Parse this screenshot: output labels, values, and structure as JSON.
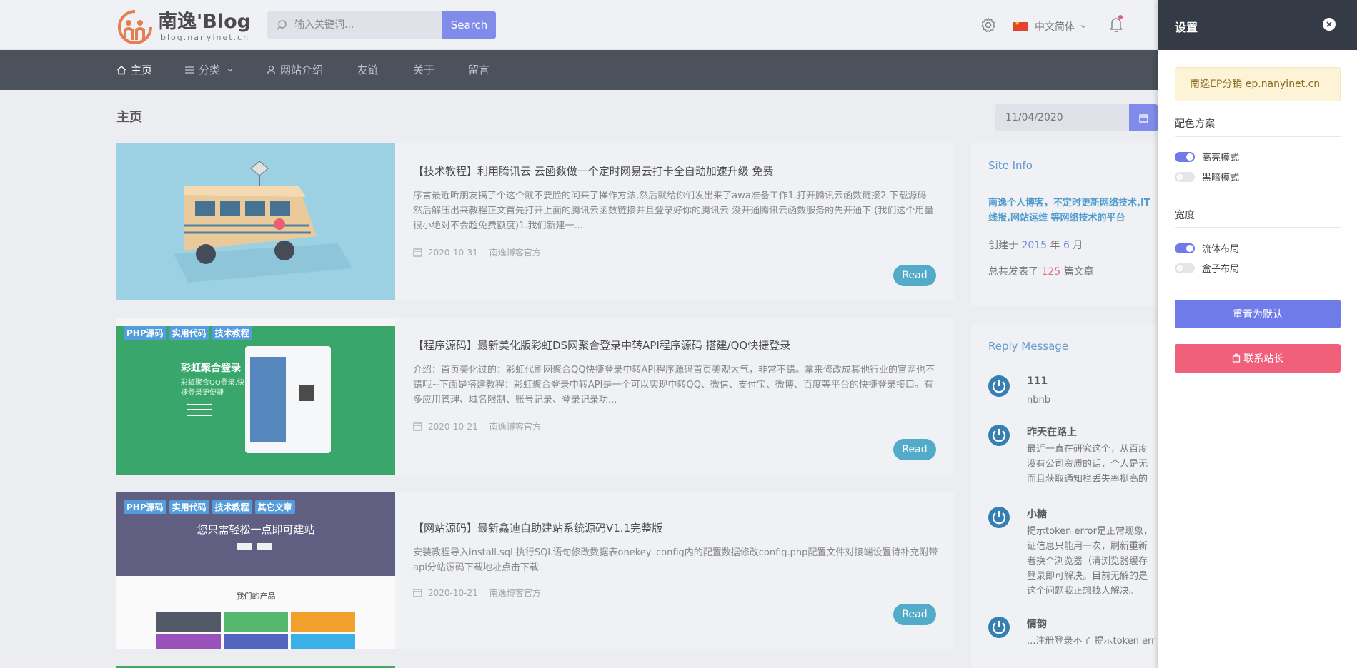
{
  "header": {
    "logo_title": "南逸'Blog",
    "logo_sub": "blog.nanyinet.cn",
    "search_placeholder": "输入关键词...",
    "search_label": "Search",
    "language": "中文简体"
  },
  "nav": {
    "items": [
      {
        "label": "主页",
        "icon": "home-icon"
      },
      {
        "label": "分类",
        "icon": "menu-icon"
      },
      {
        "label": "网站介绍",
        "icon": "user-icon"
      },
      {
        "label": "友链"
      },
      {
        "label": "关于"
      },
      {
        "label": "留言"
      }
    ]
  },
  "page": {
    "title": "主页",
    "date": "11/04/2020"
  },
  "articles": [
    {
      "title": "【技术教程】利用腾讯云 云函数做一个定时网易云打卡全自动加速升级 免费",
      "excerpt": "序言最近听朋友搞了个这个就不要脸的问来了操作方法,然后就给你们发出来了awa准备工作1.打开腾讯云函数链接2.下载源码-然后解压出来教程正文首先打开上面的腾讯云函数链接并且登录好你的腾讯云 没开通腾讯云函数服务的先开通下 (我们这个用量很小绝对不会超免费额度)1.我们新建一...",
      "date": "2020-10-31",
      "author": "南逸博客官方",
      "read_label": "Read",
      "tags": []
    },
    {
      "title": "【程序源码】最新美化版彩虹DS网聚合登录中转API程序源码 搭建/QQ快捷登录",
      "excerpt": "介绍：首页美化过的：彩虹代刷网聚合QQ快捷登录中转API程序源码首页美观大气，非常不错。拿来修改成其他行业的官网也不错哦~下面是搭建教程：彩虹聚合登录中转API是一个可以实现中转QQ、微信、支付宝、微博、百度等平台的快捷登录接口。有多应用管理、域名限制、账号记录、登录记录功...",
      "date": "2020-10-21",
      "author": "南逸博客官方",
      "read_label": "Read",
      "tags": [
        "PHP源码",
        "实用代码",
        "技术教程"
      ],
      "thumb_text": "彩虹聚合登录",
      "thumb_sub": "彩虹聚合QQ登录,快捷登录更便捷"
    },
    {
      "title": "【网站源码】最新鑫迪自助建站系统源码V1.1完整版",
      "excerpt": "安装教程导入install.sql 执行SQL语句修改数据表onekey_config内的配置数据修改config.php配置文件对接端设置待补充附带api分站源码下载地址点击下载",
      "date": "2020-10-21",
      "author": "南逸博客官方",
      "read_label": "Read",
      "tags": [
        "PHP源码",
        "实用代码",
        "技术教程",
        "其它文章"
      ],
      "thumb_text": "您只需轻松一点即可建站",
      "thumb_sub": "我们的产品"
    }
  ],
  "site_info": {
    "title": "Site Info",
    "desc": "南逸个人博客，不定时更新网络技术,IT线报,网站运维 等网络技术的平台",
    "created_prefix": "创建于",
    "created_year": "2015",
    "created_year_unit": "年",
    "created_month": "6",
    "created_month_unit": "月",
    "posts_prefix": "总共发表了",
    "posts_count": "125",
    "posts_suffix": "篇文章"
  },
  "replies": {
    "title": "Reply Message",
    "items": [
      {
        "name": "111",
        "text": "nbnb"
      },
      {
        "name": "昨天在路上",
        "text": "最近一直在研究这个，从百度\n没有公司资质的话，个人是无\n而且获取通知栏丢失率挺高的"
      },
      {
        "name": "小糖",
        "text": "提示token error是正常现象，\n证信息只能用一次，刷新重新\n者换个浏览器（清浏览器缓存\n登录即可解决。目前无解的是\n这个问题我正想找人解决。"
      },
      {
        "name": "情韵",
        "text": "...注册登录不了 提示token err"
      }
    ]
  },
  "settings": {
    "title": "设置",
    "notice": "南逸EP分销 ep.nanyinet.cn",
    "color_title": "配色方案",
    "color_options": [
      {
        "label": "高亮模式",
        "on": true
      },
      {
        "label": "黑暗模式",
        "on": false
      }
    ],
    "width_title": "宽度",
    "width_options": [
      {
        "label": "流体布局",
        "on": true
      },
      {
        "label": "盒子布局",
        "on": false
      }
    ],
    "reset_label": "重置为默认",
    "contact_label": "联系站长"
  },
  "colors": {
    "accent": "#6f7be8",
    "nav_bg": "#343b46",
    "read_button": "#3aa0c2",
    "contact_button": "#f0607a"
  }
}
